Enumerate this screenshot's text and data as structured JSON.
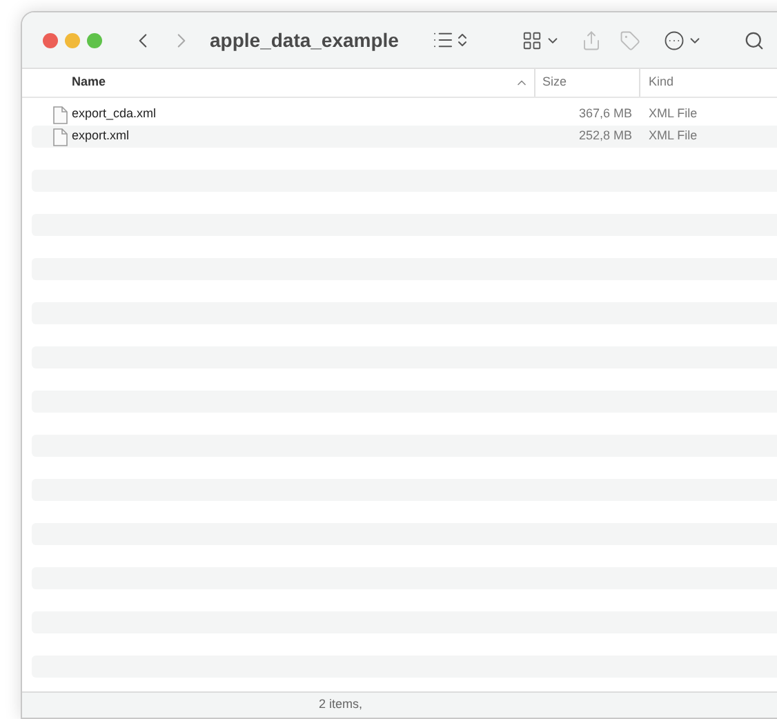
{
  "window": {
    "title": "apple_data_example"
  },
  "table": {
    "columns": [
      {
        "label": "Name",
        "sorted": true
      },
      {
        "label": "Size",
        "sorted": false
      },
      {
        "label": "Kind",
        "sorted": false
      }
    ],
    "rows": [
      {
        "name": "export_cda.xml",
        "size": "367,6 MB",
        "kind": "XML File"
      },
      {
        "name": "export.xml",
        "size": "252,8 MB",
        "kind": "XML File"
      }
    ]
  },
  "status_bar": {
    "text": "2 items,"
  }
}
